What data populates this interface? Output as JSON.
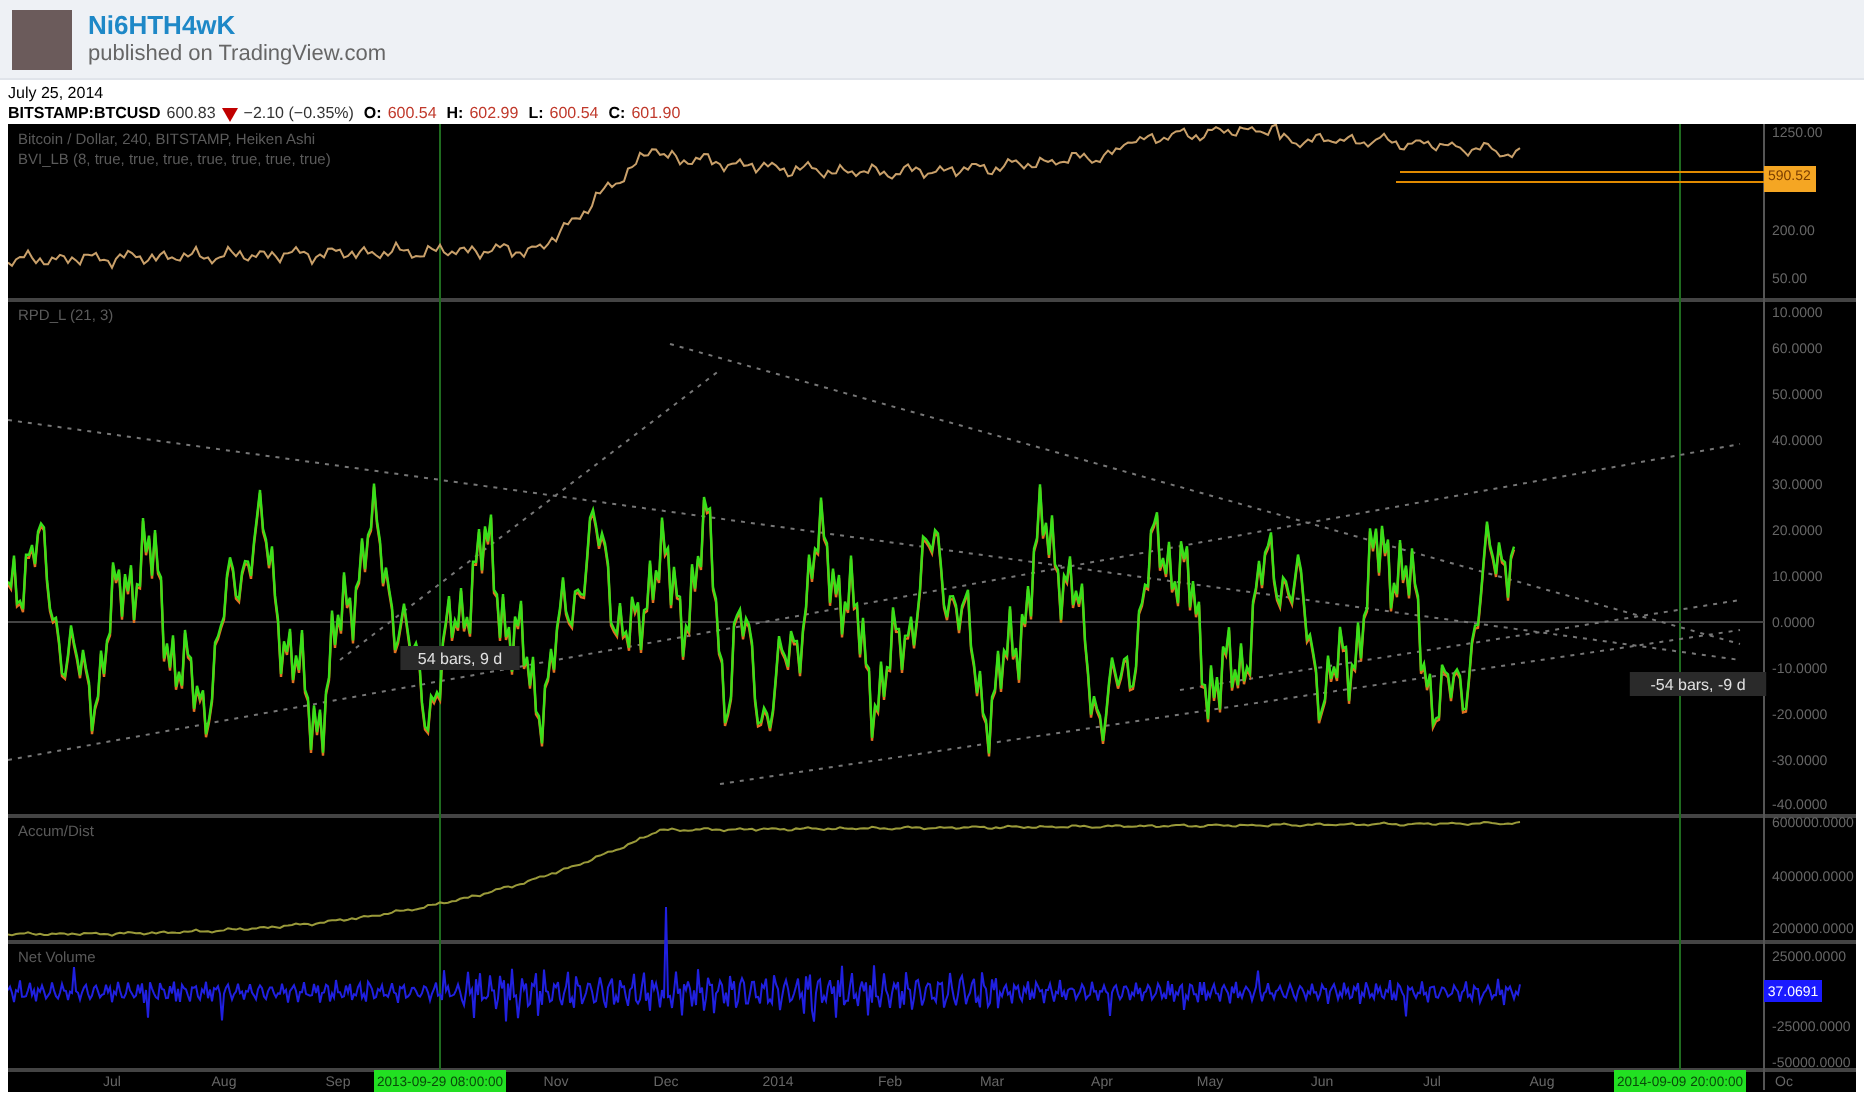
{
  "header": {
    "username": "Ni6HTH4wK",
    "subtitle": "published on TradingView.com"
  },
  "date": "July 25, 2014",
  "ticker": {
    "symbol": "BITSTAMP:BTCUSD",
    "last": "600.83",
    "change": "−2.10 (−0.35%)",
    "ohlc": [
      {
        "label": "O:",
        "value": "600.54"
      },
      {
        "label": "H:",
        "value": "602.99"
      },
      {
        "label": "L:",
        "value": "600.54"
      },
      {
        "label": "C:",
        "value": "601.90"
      }
    ]
  },
  "panes": [
    {
      "titles": [
        "Bitcoin / Dollar, 240, BITSTAMP, Heiken Ashi",
        "BVI_LB (8, true, true, true, true, true, true, true)"
      ],
      "axis_labels": [
        "1250.00",
        "200.00",
        "50.00"
      ],
      "price_tag": "590.52"
    },
    {
      "titles": [
        "RPD_L (21, 3)"
      ],
      "axis_labels": [
        "10.0000",
        "60.0000",
        "50.0000",
        "40.0000",
        "30.0000",
        "20.0000",
        "10.0000",
        "0.0000",
        "-10.0000",
        "-20.0000",
        "-30.0000",
        "-40.0000"
      ],
      "measures": [
        "54 bars, 9 d",
        "-54 bars, -9 d"
      ]
    },
    {
      "titles": [
        "Accum/Dist"
      ],
      "axis_labels": [
        "600000.0000",
        "400000.0000",
        "200000.0000"
      ]
    },
    {
      "titles": [
        "Net Volume"
      ],
      "axis_labels": [
        "25000.0000",
        "-25000.0000",
        "-50000.0000"
      ],
      "value_tag": "37.0691"
    }
  ],
  "time_axis": [
    {
      "kind": "tick",
      "text": "Jul"
    },
    {
      "kind": "tick",
      "text": "Aug"
    },
    {
      "kind": "tick",
      "text": "Sep"
    },
    {
      "kind": "crosshair",
      "text": "2013-09-29 08:00:00"
    },
    {
      "kind": "tick",
      "text": "Nov"
    },
    {
      "kind": "tick",
      "text": "Dec"
    },
    {
      "kind": "tick",
      "text": "2014"
    },
    {
      "kind": "tick",
      "text": "Feb"
    },
    {
      "kind": "tick",
      "text": "Mar"
    },
    {
      "kind": "tick",
      "text": "Apr"
    },
    {
      "kind": "tick",
      "text": "May"
    },
    {
      "kind": "tick",
      "text": "Jun"
    },
    {
      "kind": "tick",
      "text": "Jul"
    },
    {
      "kind": "tick",
      "text": "Aug"
    },
    {
      "kind": "crosshair",
      "text": "2014-09-09 20:00:00"
    },
    {
      "kind": "tick",
      "text": "Oc"
    }
  ]
}
